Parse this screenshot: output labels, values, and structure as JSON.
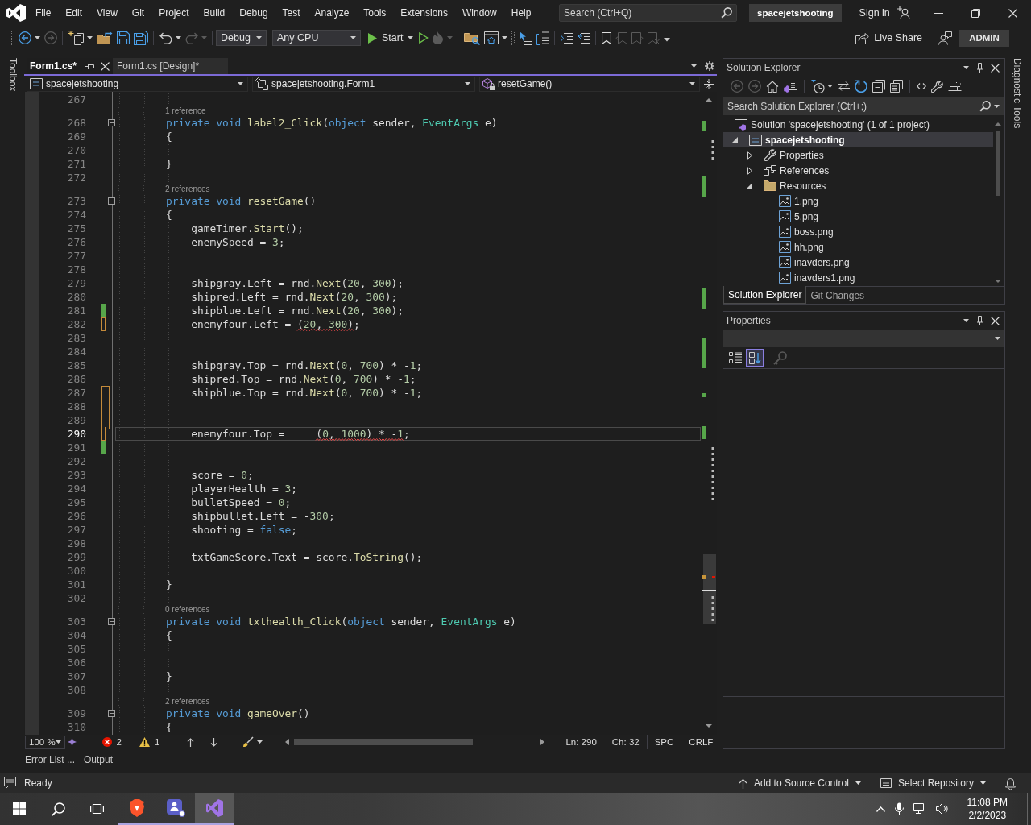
{
  "title_bar": {
    "menu": [
      "File",
      "Edit",
      "View",
      "Git",
      "Project",
      "Build",
      "Debug",
      "Test",
      "Analyze",
      "Tools",
      "Extensions",
      "Window",
      "Help"
    ],
    "search": {
      "placeholder": "Search (Ctrl+Q)"
    },
    "solution_name": "spacejetshooting",
    "sign_in": "Sign in"
  },
  "toolbar": {
    "items": [
      {
        "kind": "grip"
      },
      {
        "kind": "back",
        "disabled": false,
        "dropdown": true
      },
      {
        "kind": "forward",
        "disabled": true
      },
      {
        "kind": "separator"
      },
      {
        "kind": "newitem",
        "disabled": false,
        "dropdown": true
      },
      {
        "kind": "open",
        "disabled": false
      },
      {
        "kind": "save",
        "disabled": false
      },
      {
        "kind": "saveall",
        "disabled": false
      },
      {
        "kind": "separator"
      },
      {
        "kind": "undo",
        "disabled": false,
        "dropdown": true
      },
      {
        "kind": "redo",
        "disabled": true,
        "dropdown": true
      },
      {
        "kind": "separator"
      },
      {
        "kind": "combo",
        "value": "Debug"
      },
      {
        "kind": "combo",
        "value": "Any CPU"
      },
      {
        "kind": "start",
        "label": "Start",
        "dropdown": true
      },
      {
        "kind": "run",
        "disabled": false
      },
      {
        "kind": "hotreload",
        "disabled": true,
        "dropdown": true
      },
      {
        "kind": "separator"
      },
      {
        "kind": "findfolder",
        "disabled": false
      },
      {
        "kind": "window",
        "disabled": false,
        "dropdown": true
      },
      {
        "kind": "grip"
      },
      {
        "kind": "pointer",
        "disabled": false
      },
      {
        "kind": "panels",
        "disabled": false
      },
      {
        "kind": "separator"
      },
      {
        "kind": "indent",
        "disabled": false
      },
      {
        "kind": "outdent",
        "disabled": false
      },
      {
        "kind": "separator"
      },
      {
        "kind": "bookmark",
        "disabled": false
      },
      {
        "kind": "bookmarkprev",
        "disabled": true
      },
      {
        "kind": "bookmarknext",
        "disabled": true
      },
      {
        "kind": "bookmarkclear",
        "disabled": true
      },
      {
        "kind": "overflow"
      }
    ],
    "live_share": "Live Share",
    "account": "ADMIN"
  },
  "side_tabs": {
    "left": "Toolbox",
    "right": "Diagnostic Tools"
  },
  "editor": {
    "tabs": [
      {
        "label": "Form1.cs*",
        "selected": true
      },
      {
        "label": "Form1.cs [Design]*",
        "selected": false
      }
    ],
    "navigation": [
      "spacejetshooting",
      "spacejetshooting.Form1",
      "resetGame()"
    ],
    "lines": [
      {
        "kind": "code",
        "number": "267"
      },
      {
        "kind": "codelens",
        "text": "1 reference"
      },
      {
        "kind": "code",
        "number": "268",
        "expanded": true,
        "tokens": [
          {
            "text": "        private void ",
            "kind": "keyword"
          },
          {
            "text": "label2_Click",
            "kind": "method"
          },
          {
            "text": "(",
            "kind": "plain"
          },
          {
            "text": "object",
            "kind": "keyword"
          },
          {
            "text": " sender, ",
            "kind": "plain"
          },
          {
            "text": "EventArgs",
            "kind": "type"
          },
          {
            "text": " e)",
            "kind": "plain"
          }
        ]
      },
      {
        "kind": "code",
        "number": "269",
        "tokens": [
          {
            "text": "        {",
            "kind": "plain"
          }
        ]
      },
      {
        "kind": "code",
        "number": "270"
      },
      {
        "kind": "code",
        "number": "271",
        "tokens": [
          {
            "text": "        }",
            "kind": "plain"
          }
        ]
      },
      {
        "kind": "code",
        "number": "272"
      },
      {
        "kind": "codelens",
        "text": "2 references"
      },
      {
        "kind": "code",
        "number": "273",
        "expanded": true,
        "tokens": [
          {
            "text": "        private void ",
            "kind": "keyword"
          },
          {
            "text": "resetGame",
            "kind": "method"
          },
          {
            "text": "()",
            "kind": "plain"
          }
        ]
      },
      {
        "kind": "code",
        "number": "274",
        "tokens": [
          {
            "text": "        {",
            "kind": "plain"
          }
        ]
      },
      {
        "kind": "code",
        "number": "275",
        "tokens": [
          {
            "text": "            gameTimer.",
            "kind": "plain"
          },
          {
            "text": "Start",
            "kind": "method"
          },
          {
            "text": "();",
            "kind": "plain"
          }
        ]
      },
      {
        "kind": "code",
        "number": "276",
        "tokens": [
          {
            "text": "            enemySpeed = ",
            "kind": "plain"
          },
          {
            "text": "3",
            "kind": "number"
          },
          {
            "text": ";",
            "kind": "plain"
          }
        ]
      },
      {
        "kind": "code",
        "number": "277"
      },
      {
        "kind": "code",
        "number": "278"
      },
      {
        "kind": "code",
        "number": "279",
        "tokens": [
          {
            "text": "            shipgray.Left = rnd.",
            "kind": "plain"
          },
          {
            "text": "Next",
            "kind": "method"
          },
          {
            "text": "(",
            "kind": "plain"
          },
          {
            "text": "20",
            "kind": "number"
          },
          {
            "text": ", ",
            "kind": "plain"
          },
          {
            "text": "300",
            "kind": "number"
          },
          {
            "text": ");",
            "kind": "plain"
          }
        ]
      },
      {
        "kind": "code",
        "number": "280",
        "tokens": [
          {
            "text": "            shipred.Left = rnd.",
            "kind": "plain"
          },
          {
            "text": "Next",
            "kind": "method"
          },
          {
            "text": "(",
            "kind": "plain"
          },
          {
            "text": "20",
            "kind": "number"
          },
          {
            "text": ", ",
            "kind": "plain"
          },
          {
            "text": "300",
            "kind": "number"
          },
          {
            "text": ");",
            "kind": "plain"
          }
        ]
      },
      {
        "kind": "code",
        "number": "281",
        "modified": true,
        "saved": true,
        "tokens": [
          {
            "text": "            shipblue.Left = rnd.",
            "kind": "plain"
          },
          {
            "text": "Next",
            "kind": "method"
          },
          {
            "text": "(",
            "kind": "plain"
          },
          {
            "text": "20",
            "kind": "number"
          },
          {
            "text": ", ",
            "kind": "plain"
          },
          {
            "text": "300",
            "kind": "number"
          },
          {
            "text": ");",
            "kind": "plain"
          }
        ]
      },
      {
        "kind": "code",
        "number": "282",
        "modified": true,
        "saved": false,
        "tokens": [
          {
            "text": "            enemyfour.Left = ",
            "kind": "plain"
          },
          {
            "kind": "group",
            "error": true,
            "tokens": [
              {
                "text": "(",
                "kind": "plain"
              },
              {
                "text": "20",
                "kind": "number"
              },
              {
                "text": ", ",
                "kind": "plain"
              },
              {
                "text": "300",
                "kind": "number"
              },
              {
                "text": ")",
                "kind": "plain"
              }
            ]
          },
          {
            "text": ";",
            "kind": "plain"
          }
        ]
      },
      {
        "kind": "code",
        "number": "283"
      },
      {
        "kind": "code",
        "number": "284"
      },
      {
        "kind": "code",
        "number": "285",
        "tokens": [
          {
            "text": "            shipgray.Top = rnd.",
            "kind": "plain"
          },
          {
            "text": "Next",
            "kind": "method"
          },
          {
            "text": "(",
            "kind": "plain"
          },
          {
            "text": "0",
            "kind": "number"
          },
          {
            "text": ", ",
            "kind": "plain"
          },
          {
            "text": "700",
            "kind": "number"
          },
          {
            "text": ") * -",
            "kind": "plain"
          },
          {
            "text": "1",
            "kind": "number"
          },
          {
            "text": ";",
            "kind": "plain"
          }
        ]
      },
      {
        "kind": "code",
        "number": "286",
        "tokens": [
          {
            "text": "            shipred.Top = rnd.",
            "kind": "plain"
          },
          {
            "text": "Next",
            "kind": "method"
          },
          {
            "text": "(",
            "kind": "plain"
          },
          {
            "text": "0",
            "kind": "number"
          },
          {
            "text": ", ",
            "kind": "plain"
          },
          {
            "text": "700",
            "kind": "number"
          },
          {
            "text": ") * -",
            "kind": "plain"
          },
          {
            "text": "1",
            "kind": "number"
          },
          {
            "text": ";",
            "kind": "plain"
          }
        ]
      },
      {
        "kind": "code",
        "number": "287",
        "modified": true,
        "saved": false,
        "tokens": [
          {
            "text": "            shipblue.Top = rnd.",
            "kind": "plain"
          },
          {
            "text": "Next",
            "kind": "method"
          },
          {
            "text": "(",
            "kind": "plain"
          },
          {
            "text": "0",
            "kind": "number"
          },
          {
            "text": ", ",
            "kind": "plain"
          },
          {
            "text": "700",
            "kind": "number"
          },
          {
            "text": ") * -",
            "kind": "plain"
          },
          {
            "text": "1",
            "kind": "number"
          },
          {
            "text": ";",
            "kind": "plain"
          }
        ]
      },
      {
        "kind": "code",
        "number": "288",
        "modified": true,
        "saved": false
      },
      {
        "kind": "code",
        "number": "289",
        "modified": true,
        "saved": false
      },
      {
        "kind": "code",
        "number": "290",
        "modified": true,
        "saved": false,
        "current": true,
        "tokens": [
          {
            "text": "            enemyfour.Top =     ",
            "kind": "plain"
          },
          {
            "kind": "group",
            "error": true,
            "tokens": [
              {
                "text": "(",
                "kind": "plain"
              },
              {
                "text": "0",
                "kind": "number"
              },
              {
                "text": ", ",
                "kind": "plain"
              },
              {
                "text": "1000",
                "kind": "number"
              },
              {
                "text": ") * -",
                "kind": "plain"
              },
              {
                "text": "1",
                "kind": "number"
              }
            ]
          },
          {
            "text": ";",
            "kind": "plain"
          }
        ]
      },
      {
        "kind": "code",
        "number": "291",
        "modified": true,
        "saved": true
      },
      {
        "kind": "code",
        "number": "292"
      },
      {
        "kind": "code",
        "number": "293",
        "tokens": [
          {
            "text": "            score = ",
            "kind": "plain"
          },
          {
            "text": "0",
            "kind": "number"
          },
          {
            "text": ";",
            "kind": "plain"
          }
        ]
      },
      {
        "kind": "code",
        "number": "294",
        "tokens": [
          {
            "text": "            playerHealth = ",
            "kind": "plain"
          },
          {
            "text": "3",
            "kind": "number"
          },
          {
            "text": ";",
            "kind": "plain"
          }
        ]
      },
      {
        "kind": "code",
        "number": "295",
        "tokens": [
          {
            "text": "            bulletSpeed = ",
            "kind": "plain"
          },
          {
            "text": "0",
            "kind": "number"
          },
          {
            "text": ";",
            "kind": "plain"
          }
        ]
      },
      {
        "kind": "code",
        "number": "296",
        "tokens": [
          {
            "text": "            shipbullet.Left = -",
            "kind": "plain"
          },
          {
            "text": "300",
            "kind": "number"
          },
          {
            "text": ";",
            "kind": "plain"
          }
        ]
      },
      {
        "kind": "code",
        "number": "297",
        "tokens": [
          {
            "text": "            shooting = ",
            "kind": "plain"
          },
          {
            "text": "false",
            "kind": "keyword"
          },
          {
            "text": ";",
            "kind": "plain"
          }
        ]
      },
      {
        "kind": "code",
        "number": "298"
      },
      {
        "kind": "code",
        "number": "299",
        "tokens": [
          {
            "text": "            txtGameScore.Text = score.",
            "kind": "plain"
          },
          {
            "text": "ToString",
            "kind": "method"
          },
          {
            "text": "();",
            "kind": "plain"
          }
        ]
      },
      {
        "kind": "code",
        "number": "300"
      },
      {
        "kind": "code",
        "number": "301",
        "tokens": [
          {
            "text": "        }",
            "kind": "plain"
          }
        ]
      },
      {
        "kind": "code",
        "number": "302"
      },
      {
        "kind": "codelens",
        "text": "0 references"
      },
      {
        "kind": "code",
        "number": "303",
        "expanded": true,
        "tokens": [
          {
            "text": "        private void ",
            "kind": "keyword"
          },
          {
            "text": "txthealth_Click",
            "kind": "method"
          },
          {
            "text": "(",
            "kind": "plain"
          },
          {
            "text": "object",
            "kind": "keyword"
          },
          {
            "text": " sender, ",
            "kind": "plain"
          },
          {
            "text": "EventArgs",
            "kind": "type"
          },
          {
            "text": " e)",
            "kind": "plain"
          }
        ]
      },
      {
        "kind": "code",
        "number": "304",
        "tokens": [
          {
            "text": "        {",
            "kind": "plain"
          }
        ]
      },
      {
        "kind": "code",
        "number": "305"
      },
      {
        "kind": "code",
        "number": "306"
      },
      {
        "kind": "code",
        "number": "307",
        "tokens": [
          {
            "text": "        }",
            "kind": "plain"
          }
        ]
      },
      {
        "kind": "code",
        "number": "308"
      },
      {
        "kind": "codelens",
        "text": "2 references"
      },
      {
        "kind": "code",
        "number": "309",
        "expanded": true,
        "tokens": [
          {
            "text": "        private void ",
            "kind": "keyword"
          },
          {
            "text": "gameOver",
            "kind": "method"
          },
          {
            "text": "()",
            "kind": "plain"
          }
        ]
      },
      {
        "kind": "code",
        "number": "310",
        "tokens": [
          {
            "text": "        {",
            "kind": "plain"
          }
        ]
      }
    ],
    "status": {
      "zoom": "100 %",
      "errors": "2",
      "warnings": "1",
      "line": "Ln: 290",
      "column": "Ch: 32",
      "whitespace": "SPC",
      "line_ending": "CRLF"
    }
  },
  "bottom_tabs": [
    "Error List ...",
    "Output"
  ],
  "solution_explorer": {
    "title": "Solution Explorer",
    "toolbar": [
      {
        "kind": "back",
        "disabled": true
      },
      {
        "kind": "forward",
        "disabled": true
      },
      {
        "kind": "home",
        "disabled": false
      },
      {
        "kind": "switchviews",
        "disabled": false
      },
      {
        "kind": "separator"
      },
      {
        "kind": "pendingfilter",
        "disabled": false,
        "dropdown": true
      },
      {
        "kind": "sync",
        "disabled": false
      },
      {
        "kind": "refresh",
        "disabled": false
      },
      {
        "kind": "collapseall",
        "disabled": false
      },
      {
        "kind": "showall",
        "disabled": false
      },
      {
        "kind": "separator"
      },
      {
        "kind": "viewcode",
        "disabled": false
      },
      {
        "kind": "properties",
        "disabled": false
      },
      {
        "kind": "preview",
        "disabled": false
      }
    ],
    "search": {
      "placeholder": "Search Solution Explorer (Ctrl+;)"
    },
    "tree": [
      {
        "label": "Solution 'spacejetshooting' (1 of 1 project)",
        "kind": "solution",
        "selected": false,
        "children": [
          {
            "label": "spacejetshooting",
            "kind": "project",
            "expanded": true,
            "selected": true,
            "children": [
              {
                "label": "Properties",
                "kind": "properties",
                "expanded": false,
                "selected": false
              },
              {
                "label": "References",
                "kind": "references",
                "expanded": false,
                "selected": false
              },
              {
                "label": "Resources",
                "kind": "folder",
                "expanded": true,
                "selected": false,
                "children": [
                  {
                    "label": "1.png",
                    "kind": "image",
                    "selected": false
                  },
                  {
                    "label": "5.png",
                    "kind": "image",
                    "selected": false
                  },
                  {
                    "label": "boss.png",
                    "kind": "image",
                    "selected": false
                  },
                  {
                    "label": "hh.png",
                    "kind": "image",
                    "selected": false
                  },
                  {
                    "label": "inavders.png",
                    "kind": "image",
                    "selected": false
                  },
                  {
                    "label": "inavders1.png",
                    "kind": "image",
                    "selected": false
                  }
                ]
              }
            ]
          }
        ]
      }
    ],
    "tabs": [
      {
        "label": "Solution Explorer",
        "selected": true
      },
      {
        "label": "Git Changes",
        "selected": false
      }
    ]
  },
  "properties": {
    "title": "Properties",
    "toolbar": [
      {
        "kind": "categorized",
        "selected": false
      },
      {
        "kind": "alphabetical",
        "selected": true
      },
      {
        "kind": "separator"
      },
      {
        "kind": "propertypages",
        "disabled": true
      }
    ]
  },
  "status_bar": {
    "message": "Ready",
    "source_control": "Add to Source Control",
    "repository": "Select Repository"
  },
  "taskbar": {
    "apps": [
      {
        "kind": "browser",
        "running": true,
        "selected": false
      },
      {
        "kind": "chat",
        "running": true,
        "selected": false
      },
      {
        "kind": "ide",
        "running": true,
        "selected": true
      }
    ],
    "time": "11:08 PM",
    "date": "2/2/2023"
  }
}
